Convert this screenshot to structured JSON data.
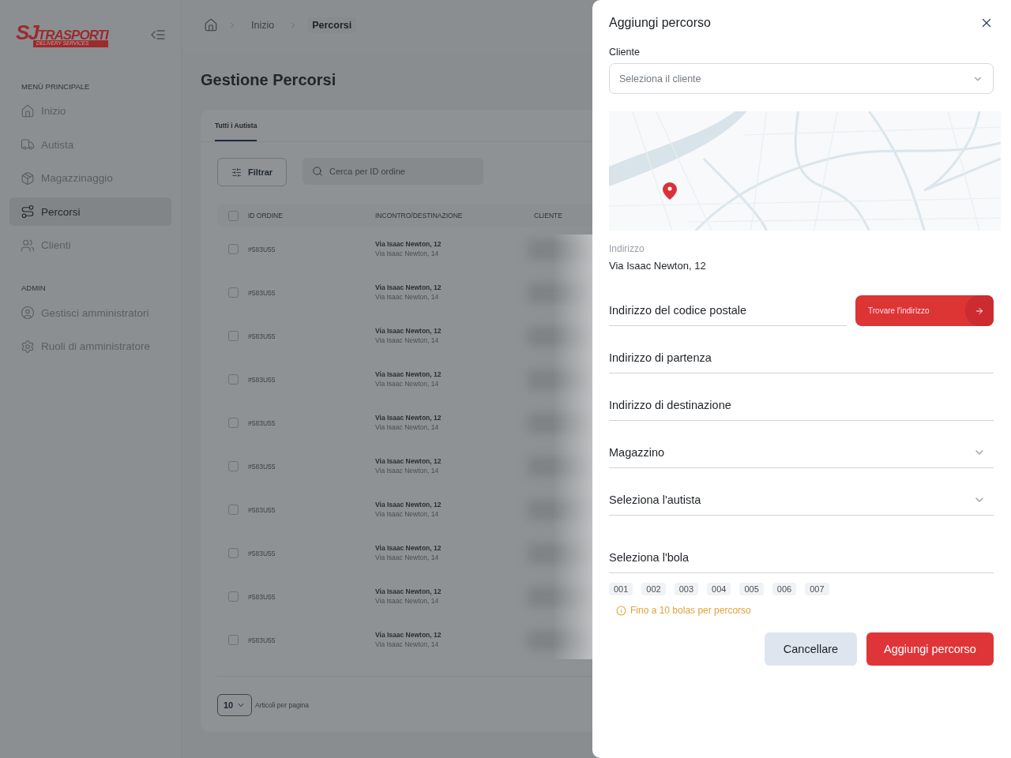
{
  "sidebar": {
    "logo": {
      "mark": "SJ",
      "name": "TRASPORTI",
      "tagline": "DELIVERY SERVICES"
    },
    "sections": [
      {
        "heading": "MENÙ PRINCIPALE",
        "items": [
          {
            "label": "Inizio",
            "selected": false
          },
          {
            "label": "Autista",
            "selected": false
          },
          {
            "label": "Magazzinaggio",
            "selected": false
          },
          {
            "label": "Percorsi",
            "selected": true
          },
          {
            "label": "Clienti",
            "selected": false
          }
        ]
      },
      {
        "heading": "ADMIN",
        "items": [
          {
            "label": "Gestisci amministratori",
            "selected": false
          },
          {
            "label": "Ruoli di amministratore",
            "selected": false
          }
        ]
      }
    ]
  },
  "breadcrumb": [
    "Inizio",
    "Percorsi"
  ],
  "page_title": "Gestione Percorsi",
  "tabs": [
    {
      "label": "Tutti i Autista",
      "selected": true
    }
  ],
  "filter_button": "Filtrar",
  "search": {
    "placeholder": "Cerca per ID ordine"
  },
  "table": {
    "header_checked": false,
    "columns": [
      "ID ORDINE",
      "INCONTRO/DESTINAZIONE",
      "CLIENTE"
    ],
    "rows": [
      {
        "checked": false,
        "id": "#583U55",
        "from": "Via Isaac Newton, 12",
        "to": "Via Isaac Newton, 14"
      },
      {
        "checked": false,
        "id": "#583U55",
        "from": "Via Isaac Newton, 12",
        "to": "Via Isaac Newton, 14"
      },
      {
        "checked": false,
        "id": "#583U55",
        "from": "Via Isaac Newton, 12",
        "to": "Via Isaac Newton, 14"
      },
      {
        "checked": false,
        "id": "#583U55",
        "from": "Via Isaac Newton, 12",
        "to": "Via Isaac Newton, 14"
      },
      {
        "checked": false,
        "id": "#583U55",
        "from": "Via Isaac Newton, 12",
        "to": "Via Isaac Newton, 14"
      },
      {
        "checked": false,
        "id": "#583U55",
        "from": "Via Isaac Newton, 12",
        "to": "Via Isaac Newton, 14"
      },
      {
        "checked": false,
        "id": "#583U55",
        "from": "Via Isaac Newton, 12",
        "to": "Via Isaac Newton, 14"
      },
      {
        "checked": false,
        "id": "#583U55",
        "from": "Via Isaac Newton, 12",
        "to": "Via Isaac Newton, 14"
      },
      {
        "checked": false,
        "id": "#583U55",
        "from": "Via Isaac Newton, 12",
        "to": "Via Isaac Newton, 14"
      },
      {
        "checked": false,
        "id": "#583U55",
        "from": "Via Isaac Newton, 12",
        "to": "Via Isaac Newton, 14"
      }
    ]
  },
  "pagination": {
    "page_size": "10",
    "label": "Articoli per pagina"
  },
  "drawer": {
    "title": "Aggiungi percorso",
    "client": {
      "label": "Cliente",
      "placeholder": "Seleziona il cliente"
    },
    "address": {
      "label": "Indirizzo",
      "value": "Via Isaac Newton, 12"
    },
    "postal": {
      "placeholder": "Indirizzo del codice postale"
    },
    "find_button": "Trovare l'indirizzo",
    "fields": [
      {
        "kind": "input",
        "placeholder": "Indirizzo di partenza"
      },
      {
        "kind": "input",
        "placeholder": "Indirizzo di destinazione"
      },
      {
        "kind": "select",
        "placeholder": "Magazzino"
      },
      {
        "kind": "select",
        "placeholder": "Seleziona l'autista"
      },
      {
        "kind": "input",
        "placeholder": "Seleziona l'bola"
      }
    ],
    "tags": [
      "001",
      "002",
      "003",
      "004",
      "005",
      "006",
      "007"
    ],
    "hint": "Fino a 10 bolas per percorso",
    "cancel_button": "Cancellare",
    "submit_button": "Aggiungi percorso"
  }
}
